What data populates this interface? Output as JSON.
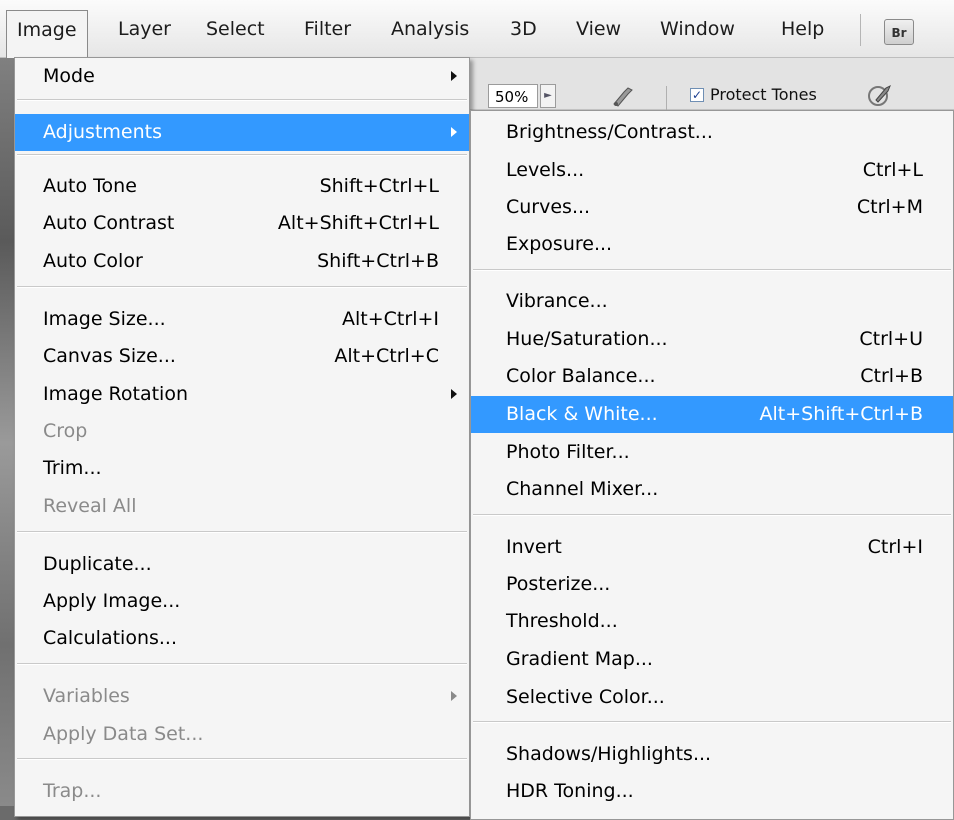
{
  "menubar": {
    "items": [
      {
        "label": "Image"
      },
      {
        "label": "Layer"
      },
      {
        "label": "Select"
      },
      {
        "label": "Filter"
      },
      {
        "label": "Analysis"
      },
      {
        "label": "3D"
      },
      {
        "label": "View"
      },
      {
        "label": "Window"
      },
      {
        "label": "Help"
      }
    ],
    "bridge_label": "Br"
  },
  "options_bar": {
    "zoom_value": "50%",
    "protect_tones_label": "Protect Tones",
    "protect_tones_checked": true
  },
  "image_menu": {
    "items": [
      {
        "label": "Mode",
        "shortcut": "",
        "submenu": true,
        "disabled": false
      },
      {
        "label": "Adjustments",
        "shortcut": "",
        "submenu": true,
        "disabled": false,
        "highlighted": true
      },
      {
        "label": "Auto Tone",
        "shortcut": "Shift+Ctrl+L",
        "disabled": false
      },
      {
        "label": "Auto Contrast",
        "shortcut": "Alt+Shift+Ctrl+L",
        "disabled": false
      },
      {
        "label": "Auto Color",
        "shortcut": "Shift+Ctrl+B",
        "disabled": false
      },
      {
        "label": "Image Size...",
        "shortcut": "Alt+Ctrl+I",
        "disabled": false
      },
      {
        "label": "Canvas Size...",
        "shortcut": "Alt+Ctrl+C",
        "disabled": false
      },
      {
        "label": "Image Rotation",
        "shortcut": "",
        "submenu": true,
        "disabled": false
      },
      {
        "label": "Crop",
        "shortcut": "",
        "disabled": true
      },
      {
        "label": "Trim...",
        "shortcut": "",
        "disabled": false
      },
      {
        "label": "Reveal All",
        "shortcut": "",
        "disabled": true
      },
      {
        "label": "Duplicate...",
        "shortcut": "",
        "disabled": false
      },
      {
        "label": "Apply Image...",
        "shortcut": "",
        "disabled": false
      },
      {
        "label": "Calculations...",
        "shortcut": "",
        "disabled": false
      },
      {
        "label": "Variables",
        "shortcut": "",
        "submenu": true,
        "disabled": true
      },
      {
        "label": "Apply Data Set...",
        "shortcut": "",
        "disabled": true
      },
      {
        "label": "Trap...",
        "shortcut": "",
        "disabled": true
      }
    ]
  },
  "adjustments_menu": {
    "items": [
      {
        "label": "Brightness/Contrast...",
        "shortcut": ""
      },
      {
        "label": "Levels...",
        "shortcut": "Ctrl+L"
      },
      {
        "label": "Curves...",
        "shortcut": "Ctrl+M"
      },
      {
        "label": "Exposure...",
        "shortcut": ""
      },
      {
        "label": "Vibrance...",
        "shortcut": ""
      },
      {
        "label": "Hue/Saturation...",
        "shortcut": "Ctrl+U"
      },
      {
        "label": "Color Balance...",
        "shortcut": "Ctrl+B"
      },
      {
        "label": "Black & White...",
        "shortcut": "Alt+Shift+Ctrl+B",
        "highlighted": true
      },
      {
        "label": "Photo Filter...",
        "shortcut": ""
      },
      {
        "label": "Channel Mixer...",
        "shortcut": ""
      },
      {
        "label": "Invert",
        "shortcut": "Ctrl+I"
      },
      {
        "label": "Posterize...",
        "shortcut": ""
      },
      {
        "label": "Threshold...",
        "shortcut": ""
      },
      {
        "label": "Gradient Map...",
        "shortcut": ""
      },
      {
        "label": "Selective Color...",
        "shortcut": ""
      },
      {
        "label": "Shadows/Highlights...",
        "shortcut": ""
      },
      {
        "label": "HDR Toning...",
        "shortcut": ""
      }
    ]
  },
  "colors": {
    "highlight": "#3399ff",
    "menu_bg": "#f5f5f5",
    "disabled_text": "#8a8a8a"
  }
}
